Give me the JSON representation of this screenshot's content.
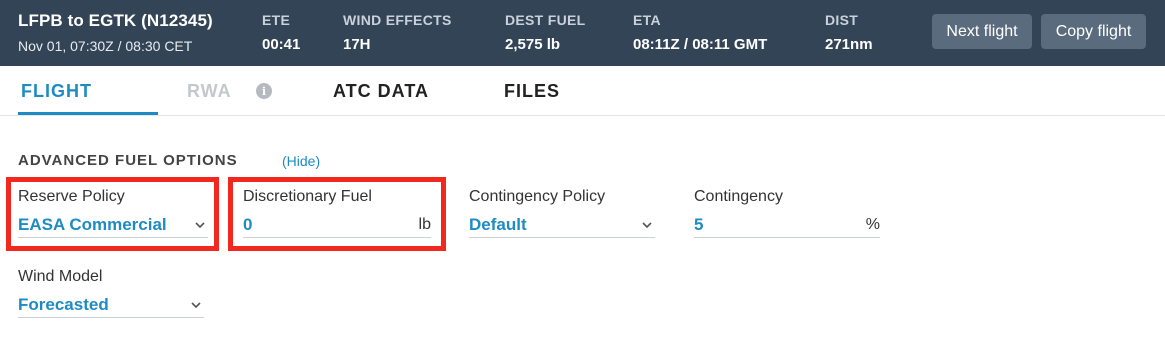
{
  "header": {
    "route_title": "LFPB to EGTK (N12345)",
    "route_sub": "Nov 01, 07:30Z / 08:30 CET",
    "stats": [
      {
        "label": "ETE",
        "value": "00:41"
      },
      {
        "label": "WIND EFFECTS",
        "value": "17H"
      },
      {
        "label": "DEST FUEL",
        "value": "2,575 lb"
      },
      {
        "label": "ETA",
        "value": "08:11Z / 08:11 GMT"
      },
      {
        "label": "DIST",
        "value": "271nm"
      }
    ],
    "next_flight_label": "Next flight",
    "copy_flight_label": "Copy flight"
  },
  "tabs": [
    {
      "label": "FLIGHT",
      "state": "active"
    },
    {
      "label": "RWA",
      "state": "disabled"
    },
    {
      "label": "ATC DATA",
      "state": "normal"
    },
    {
      "label": "FILES",
      "state": "normal"
    }
  ],
  "section": {
    "title": "ADVANCED FUEL OPTIONS",
    "hide_label": "(Hide)"
  },
  "fields": {
    "reserve_policy": {
      "label": "Reserve Policy",
      "value": "EASA Commercial"
    },
    "discretionary_fuel": {
      "label": "Discretionary Fuel",
      "value": "0",
      "unit": "lb"
    },
    "contingency_policy": {
      "label": "Contingency Policy",
      "value": "Default"
    },
    "contingency": {
      "label": "Contingency",
      "value": "5",
      "unit": "%"
    },
    "wind_model": {
      "label": "Wind Model",
      "value": "Forecasted"
    }
  },
  "icons": {
    "info": "info-icon",
    "dropdown": "chevron-down-icon"
  },
  "colors": {
    "header_bg": "#344457",
    "accent": "#1e8bc3",
    "highlight": "#f0281e",
    "button_bg": "#5b6b7e"
  }
}
